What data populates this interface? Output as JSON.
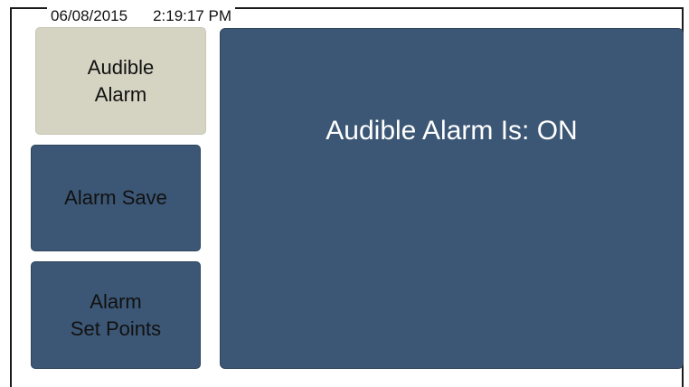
{
  "header": {
    "date": "06/08/2015",
    "time": "2:19:17 PM"
  },
  "sidebar": {
    "buttons": [
      {
        "line1": "Audible",
        "line2": "Alarm",
        "active": true
      },
      {
        "line1": "Alarm Save",
        "active": false
      },
      {
        "line1": "Alarm",
        "line2": "Set Points",
        "active": false
      }
    ]
  },
  "main": {
    "status_text": "Audible Alarm Is: ON"
  },
  "colors": {
    "panel": "#3c5775",
    "active_button": "#d5d3c2",
    "status_text": "#ffffff"
  }
}
